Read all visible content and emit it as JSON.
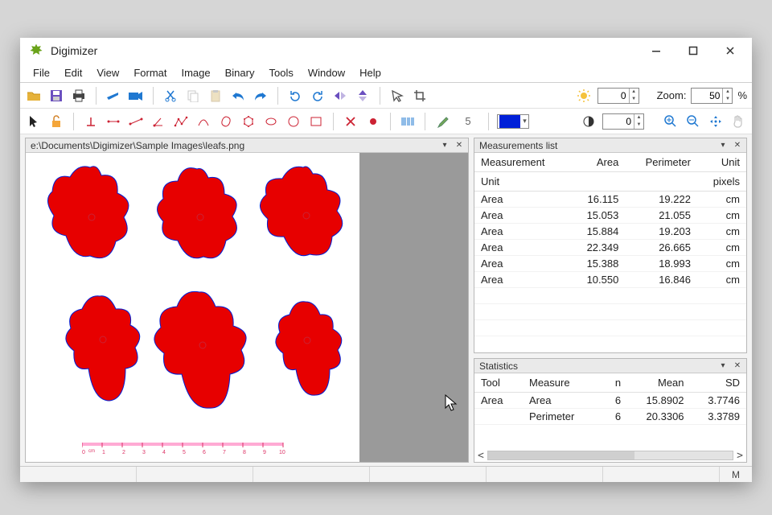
{
  "app": {
    "title": "Digimizer"
  },
  "menus": [
    "File",
    "Edit",
    "View",
    "Format",
    "Image",
    "Binary",
    "Tools",
    "Window",
    "Help"
  ],
  "toolbar": {
    "brightness_value": "0",
    "contrast_value": "0",
    "zoom_label": "Zoom:",
    "zoom_value": "50",
    "zoom_suffix": "%",
    "line_count": "5"
  },
  "image_panel": {
    "path": "e:\\Documents\\Digimizer\\Sample Images\\leafs.png",
    "ruler_ticks": [
      "0",
      "1",
      "2",
      "3",
      "4",
      "5",
      "6",
      "7",
      "8",
      "9",
      "10"
    ],
    "ruler_unit": "cm"
  },
  "measurements": {
    "title": "Measurements list",
    "cols": [
      "Measurement",
      "Area",
      "Perimeter",
      "Unit"
    ],
    "subheader": {
      "measurement": "Unit",
      "unit": "pixels"
    },
    "rows": [
      {
        "measurement": "Area",
        "area": "16.115",
        "perimeter": "19.222",
        "unit": "cm"
      },
      {
        "measurement": "Area",
        "area": "15.053",
        "perimeter": "21.055",
        "unit": "cm"
      },
      {
        "measurement": "Area",
        "area": "15.884",
        "perimeter": "19.203",
        "unit": "cm"
      },
      {
        "measurement": "Area",
        "area": "22.349",
        "perimeter": "26.665",
        "unit": "cm"
      },
      {
        "measurement": "Area",
        "area": "15.388",
        "perimeter": "18.993",
        "unit": "cm"
      },
      {
        "measurement": "Area",
        "area": "10.550",
        "perimeter": "16.846",
        "unit": "cm"
      }
    ]
  },
  "stats": {
    "title": "Statistics",
    "cols": [
      "Tool",
      "Measure",
      "n",
      "Mean",
      "SD"
    ],
    "rows": [
      {
        "tool": "Area",
        "measure": "Area",
        "n": "6",
        "mean": "15.8902",
        "sd": "3.7746"
      },
      {
        "tool": "",
        "measure": "Perimeter",
        "n": "6",
        "mean": "20.3306",
        "sd": "3.3789"
      }
    ]
  },
  "statusbar": {
    "mode": "M"
  },
  "colors": {
    "accent": "#e70000",
    "swatch": "#0020d8"
  }
}
